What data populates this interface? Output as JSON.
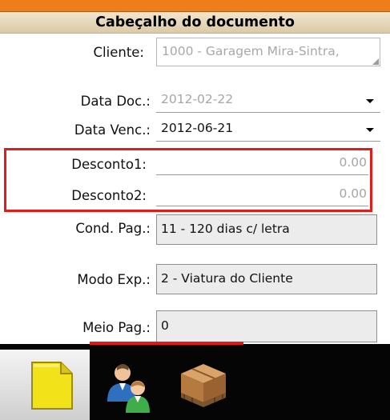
{
  "header": {
    "title": "Cabeçalho do documento"
  },
  "fields": {
    "cliente": {
      "label": "Cliente:",
      "value": "1000 - Garagem Mira-Sintra,"
    },
    "data_doc": {
      "label": "Data Doc.:",
      "value": "2012-02-22"
    },
    "data_venc": {
      "label": "Data Venc.:",
      "value": "2012-06-21"
    },
    "desconto1": {
      "label": "Desconto1:",
      "value": "0.00"
    },
    "desconto2": {
      "label": "Desconto2:",
      "value": "0.00"
    },
    "cond_pag": {
      "label": "Cond. Pag.:",
      "value": "11 - 120 dias c/ letra"
    },
    "modo_exp": {
      "label": "Modo Exp.:",
      "value": "2 - Viatura do Cliente"
    },
    "meio_pag": {
      "label": "Meio Pag.:",
      "value": "0"
    }
  },
  "tabs": [
    {
      "icon": "document-icon",
      "selected": true
    },
    {
      "icon": "users-icon",
      "selected": false
    },
    {
      "icon": "package-icon",
      "selected": false
    }
  ],
  "colors": {
    "accent_orange": "#ef7d1a",
    "highlight_red": "#e31b1b",
    "toolbar_black": "#050505"
  }
}
